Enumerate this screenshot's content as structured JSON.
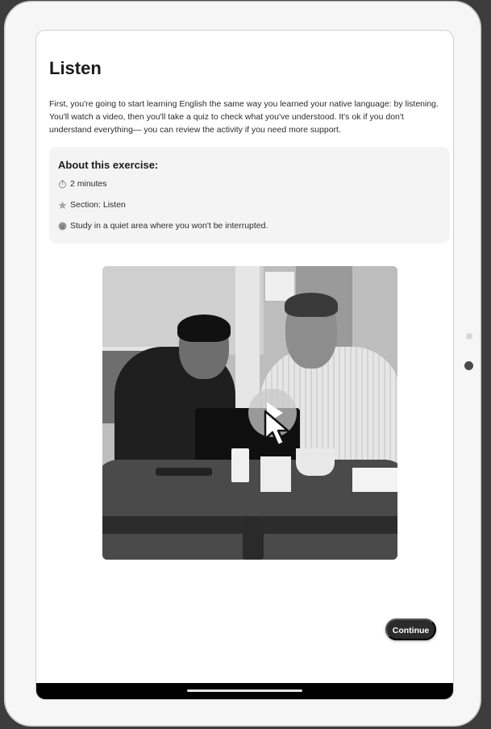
{
  "page": {
    "title": "Listen",
    "intro": "First, you're going to start learning English the same way you learned your native language: by listening. You'll watch a video, then you'll take a quiz to check what you've understood. It's ok if you don't understand everything— you can review the activity if you need more support."
  },
  "about": {
    "title": "About this exercise:",
    "items": [
      {
        "icon": "stopwatch-icon",
        "text": "2 minutes"
      },
      {
        "icon": "star-icon",
        "text": "Section: Listen"
      },
      {
        "icon": "face-icon",
        "text": "Study in a quiet area where you won't be interrupted."
      }
    ]
  },
  "video": {
    "play_icon": "play-icon",
    "cursor_icon": "cursor-icon"
  },
  "actions": {
    "continue_label": "Continue"
  },
  "colors": {
    "button_bg": "#2b2b2b",
    "panel_bg": "#f4f4f4"
  }
}
